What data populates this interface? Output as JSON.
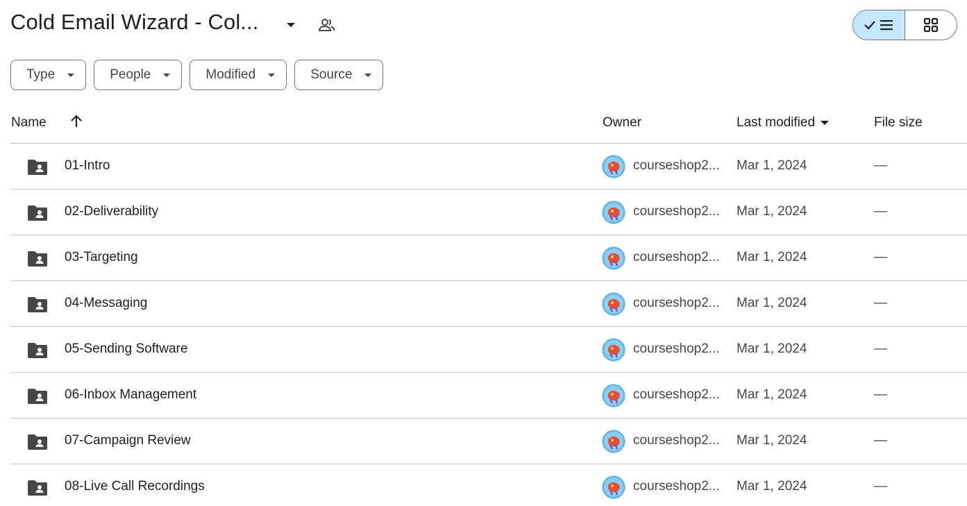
{
  "header": {
    "title": "Cold Email Wizard - Col...",
    "title_menu_icon": "arrow-drop-down-icon",
    "shared_icon": "people-icon",
    "view_toggle": {
      "list_icon": "check-list-icon",
      "grid_icon": "grid-icon",
      "selected": "list",
      "selected_color": "#c2e7ff"
    }
  },
  "filters": [
    {
      "label": "Type"
    },
    {
      "label": "People"
    },
    {
      "label": "Modified"
    },
    {
      "label": "Source"
    }
  ],
  "columns": {
    "name": "Name",
    "owner": "Owner",
    "last_modified": "Last modified",
    "file_size": "File size",
    "sort_icon": "arrow-up-icon"
  },
  "rows": [
    {
      "name": "01-Intro",
      "owner": "courseshop2...",
      "modified": "Mar 1, 2024",
      "size": "—",
      "icon": "shared-folder-icon"
    },
    {
      "name": "02-Deliverability",
      "owner": "courseshop2...",
      "modified": "Mar 1, 2024",
      "size": "—",
      "icon": "shared-folder-icon"
    },
    {
      "name": "03-Targeting",
      "owner": "courseshop2...",
      "modified": "Mar 1, 2024",
      "size": "—",
      "icon": "shared-folder-icon"
    },
    {
      "name": "04-Messaging",
      "owner": "courseshop2...",
      "modified": "Mar 1, 2024",
      "size": "—",
      "icon": "shared-folder-icon"
    },
    {
      "name": "05-Sending Software",
      "owner": "courseshop2...",
      "modified": "Mar 1, 2024",
      "size": "—",
      "icon": "shared-folder-icon"
    },
    {
      "name": "06-Inbox Management",
      "owner": "courseshop2...",
      "modified": "Mar 1, 2024",
      "size": "—",
      "icon": "shared-folder-icon"
    },
    {
      "name": "07-Campaign Review",
      "owner": "courseshop2...",
      "modified": "Mar 1, 2024",
      "size": "—",
      "icon": "shared-folder-icon"
    },
    {
      "name": "08-Live Call Recordings",
      "owner": "courseshop2...",
      "modified": "Mar 1, 2024",
      "size": "—",
      "icon": "shared-folder-icon"
    }
  ],
  "colors": {
    "text_primary": "#1f1f1f",
    "text_secondary": "#444746",
    "border": "#747775",
    "divider": "#c4c7c5",
    "folder": "#444746"
  }
}
